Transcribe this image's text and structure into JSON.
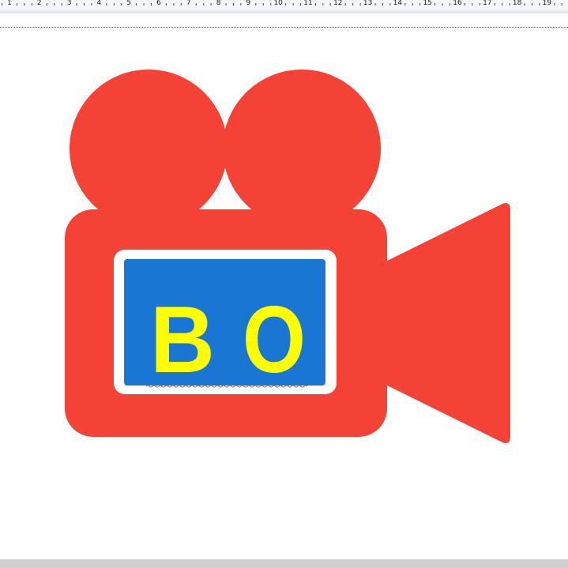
{
  "ruler": {
    "labels": [
      "1",
      "2",
      "3",
      "4",
      "5",
      "6",
      "7",
      "8",
      "9",
      "10",
      "11",
      "12",
      "13",
      "14",
      "15",
      "16",
      "17",
      "18",
      "19"
    ]
  },
  "logo": {
    "letter_left": "B",
    "letter_right": "O",
    "colors": {
      "camera": "#f44336",
      "screen_border": "#ffffff",
      "screen": "#1976d2",
      "letters": "#ffff00"
    }
  }
}
